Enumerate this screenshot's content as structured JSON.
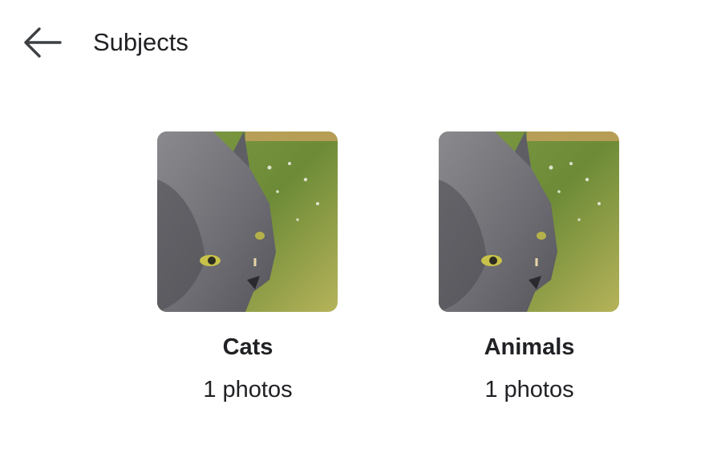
{
  "header": {
    "back_icon": "arrow-left-icon",
    "title": "Subjects"
  },
  "subjects": [
    {
      "name": "Cats",
      "count_label": "1 photos",
      "thumbnail": "gray-cat-photo"
    },
    {
      "name": "Animals",
      "count_label": "1 photos",
      "thumbnail": "gray-cat-photo"
    }
  ],
  "colors": {
    "text": "#202124",
    "background": "#ffffff",
    "icon": "#3c4043"
  }
}
